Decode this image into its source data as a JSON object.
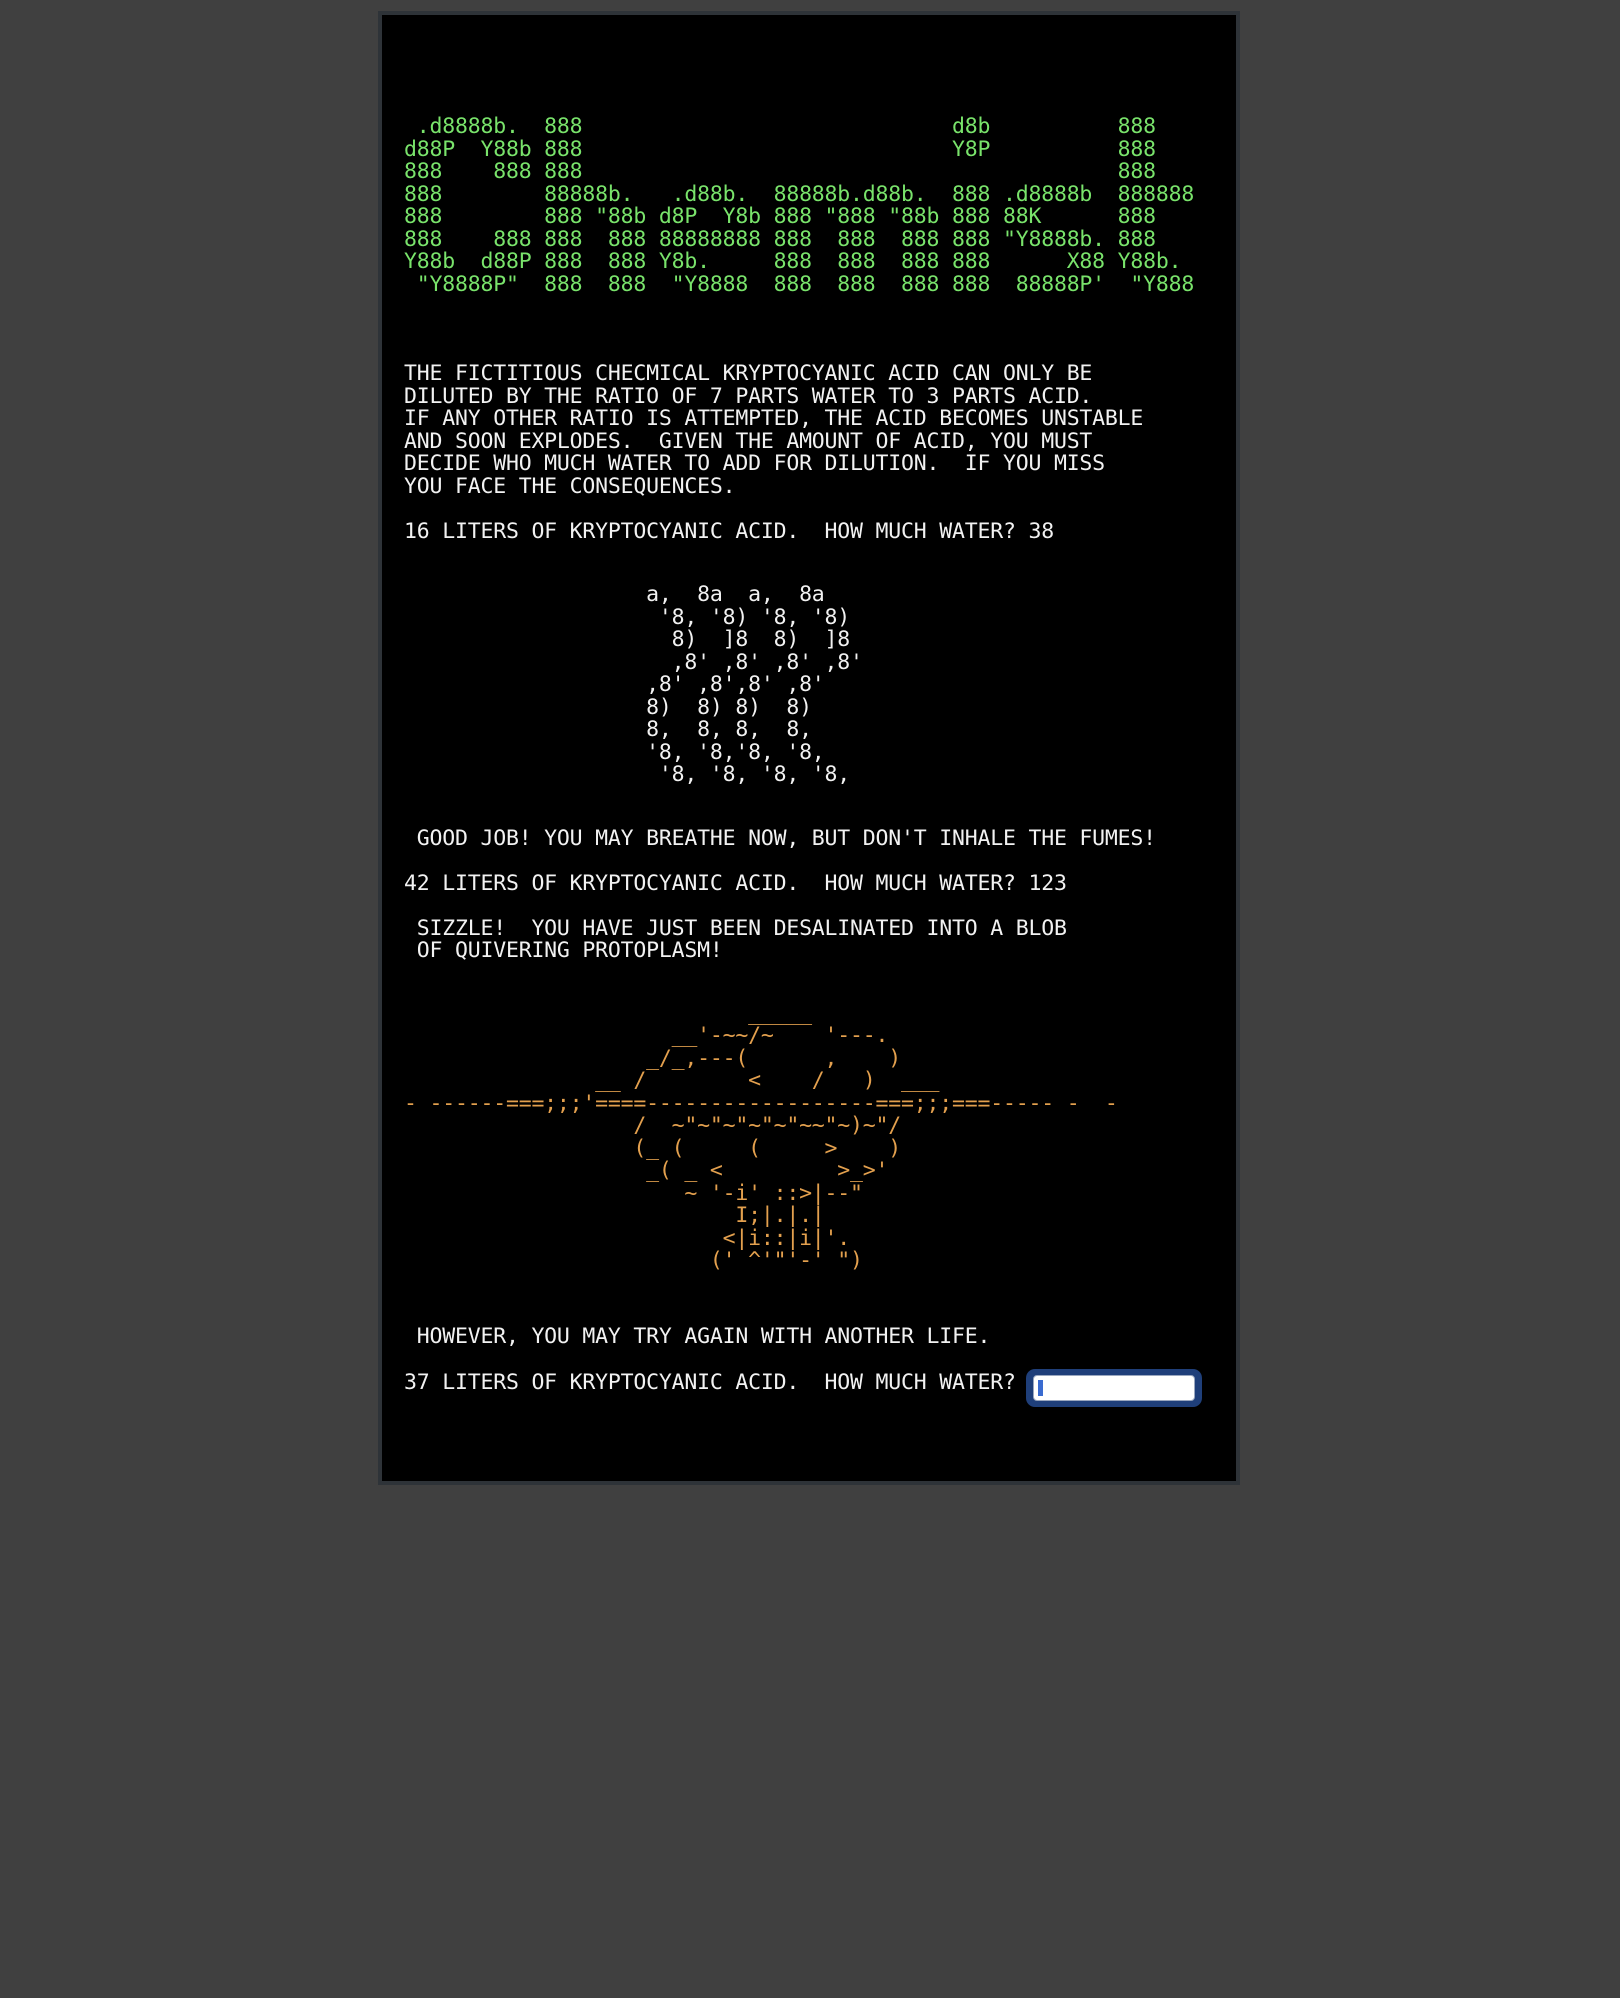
{
  "terminal": {
    "banner": " .d8888b.  888                             d8b          888\nd88P  Y88b 888                             Y8P          888\n888    888 888                                          888\n888        88888b.   .d88b.  88888b.d88b.  888 .d8888b  888888\n888        888 \"88b d8P  Y8b 888 \"888 \"88b 888 88K      888\n888    888 888  888 88888888 888  888  888 888 \"Y8888b. 888\nY88b  d88P 888  888 Y8b.     888  888  888 888      X88 Y88b.\n \"Y8888P\"  888  888  \"Y8888  888  888  888 888  88888P'  \"Y888",
    "intro": "THE FICTITIOUS CHECMICAL KRYPTOCYANIC ACID CAN ONLY BE\nDILUTED BY THE RATIO OF 7 PARTS WATER TO 3 PARTS ACID.\nIF ANY OTHER RATIO IS ATTEMPTED, THE ACID BECOMES UNSTABLE\nAND SOON EXPLODES.  GIVEN THE AMOUNT OF ACID, YOU MUST\nDECIDE WHO MUCH WATER TO ADD FOR DILUTION.  IF YOU MISS\nYOU FACE THE CONSEQUENCES.",
    "round1_prompt": "16 LITERS OF KRYPTOCYANIC ACID.  HOW MUCH WATER? 38",
    "fumes_art": "                   a,  8a  a,  8a\n                    '8, '8) '8, '8)\n                     8)  ]8  8)  ]8\n                     ,8' ,8' ,8' ,8'\n                   ,8' ,8',8' ,8'\n                   8)  8) 8)  8)\n                   8,  8, 8,  8,\n                   '8, '8,'8, '8,\n                    '8, '8, '8, '8,",
    "round1_result": " GOOD JOB! YOU MAY BREATHE NOW, BUT DON'T INHALE THE FUMES!",
    "round2_prompt": "42 LITERS OF KRYPTOCYANIC ACID.  HOW MUCH WATER? 123",
    "round2_result": " SIZZLE!  YOU HAVE JUST BEEN DESALINATED INTO A BLOB\n OF QUIVERING PROTOPLASM!",
    "explosion_art": "                           _____\n                     __'-~~/~    '---.\n                   _/_,---(      ,    )\n               __ /        <    /   )  ___\n- ------===;;;'====------------------===;;;===----- -  -\n                  /  ~\"~\"~\"~\"~\"~~\"~)~\"/\n                  (_ (     (     >    )\n                   _( _ <         >_>'\n                      ~ '-i' ::>|--\"\n                          I;|.|.|\n                         <|i::|i|'.\n                        (' ^'\"'-' \")",
    "round2_epilogue": " HOWEVER, YOU MAY TRY AGAIN WITH ANOTHER LIFE.",
    "round3_prompt": "37 LITERS OF KRYPTOCYANIC ACID.  HOW MUCH WATER? ",
    "answer_value": ""
  },
  "colors": {
    "page_background": "#404040",
    "terminal_background": "#000000",
    "banner_text": "#79e36b",
    "body_text": "#f2f2f2",
    "explosion_art": "#e3a04e",
    "input_focus_ring": "#1f3f7a"
  }
}
